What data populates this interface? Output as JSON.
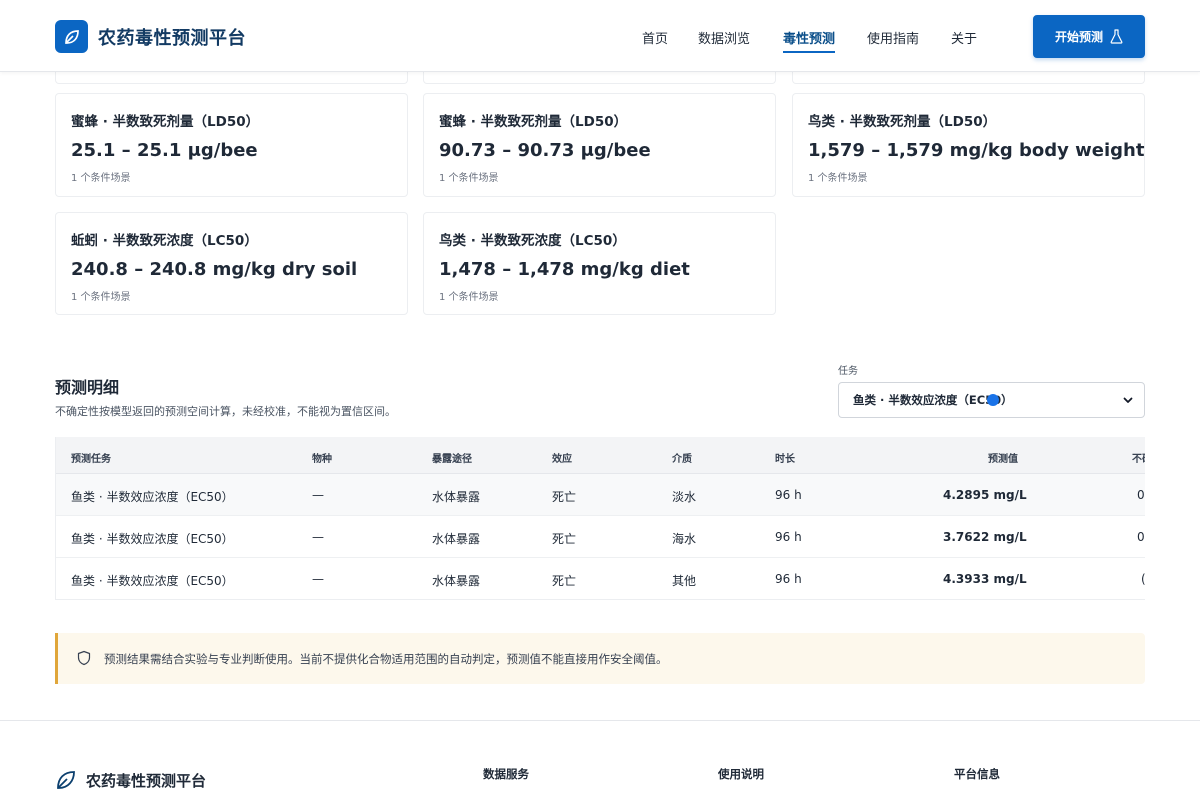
{
  "header": {
    "brand_title": "农药毒性预测平台",
    "nav": [
      {
        "label": "首页",
        "active": false
      },
      {
        "label": "数据浏览",
        "active": false
      },
      {
        "label": "毒性预测",
        "active": true
      },
      {
        "label": "使用指南",
        "active": false
      },
      {
        "label": "关于",
        "active": false
      }
    ],
    "cta_label": "开始预测",
    "accent_color": "#0b66c3"
  },
  "cards": [
    {
      "title": "蜜蜂 · 半数致死剂量（LD50）",
      "value": "25.1 – 25.1 μg/bee",
      "sub": "1 个条件场景"
    },
    {
      "title": "蜜蜂 · 半数致死剂量（LD50）",
      "value": "90.73 – 90.73 μg/bee",
      "sub": "1 个条件场景"
    },
    {
      "title": "鸟类 · 半数致死剂量（LD50）",
      "value": "1,579 – 1,579 mg/kg body weight",
      "sub": "1 个条件场景"
    },
    {
      "title": "蚯蚓 · 半数致死浓度（LC50）",
      "value": "240.8 – 240.8 mg/kg dry soil",
      "sub": "1 个条件场景"
    },
    {
      "title": "鸟类 · 半数致死浓度（LC50）",
      "value": "1,478 – 1,478 mg/kg diet",
      "sub": "1 个条件场景"
    }
  ],
  "details": {
    "title": "预测明细",
    "description": "不确定性按模型返回的预测空间计算，未经校准，不能视为置信区间。",
    "task_label": "任务",
    "task_selected": "鱼类 · 半数效应浓度（EC50）"
  },
  "table": {
    "columns": [
      "预测任务",
      "物种",
      "暴露途径",
      "效应",
      "介质",
      "时长",
      "预测值",
      "不确"
    ],
    "rows": [
      [
        "鱼类 · 半数效应浓度（EC50）",
        "—",
        "水体暴露",
        "死亡",
        "淡水",
        "96 h",
        "4.2895 mg/L",
        "0."
      ],
      [
        "鱼类 · 半数效应浓度（EC50）",
        "—",
        "水体暴露",
        "死亡",
        "海水",
        "96 h",
        "3.7622 mg/L",
        "0."
      ],
      [
        "鱼类 · 半数效应浓度（EC50）",
        "—",
        "水体暴露",
        "死亡",
        "其他",
        "96 h",
        "4.3933 mg/L",
        "("
      ]
    ]
  },
  "alert": {
    "text": "预测结果需结合实验与专业判断使用。当前不提供化合物适用范围的自动判定，预测值不能直接用作安全阈值。",
    "border_color": "#e0a63a"
  },
  "footer": {
    "brand_title": "农药毒性预测平台",
    "columns": [
      "数据服务",
      "使用说明",
      "平台信息"
    ]
  }
}
